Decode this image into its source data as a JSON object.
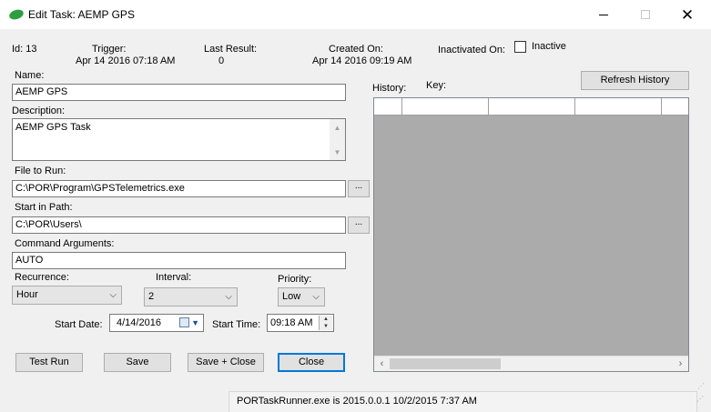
{
  "window": {
    "title": "Edit Task: AEMP GPS"
  },
  "info": {
    "id_label": "Id: 13",
    "trigger_label": "Trigger:",
    "trigger_value": "Apr 14 2016 07:18 AM",
    "last_result_label": "Last Result:",
    "last_result_value": "0",
    "created_label": "Created On:",
    "created_value": "Apr 14 2016 09:19 AM",
    "inactivated_label": "Inactivated On:",
    "inactive_label": "Inactive"
  },
  "form": {
    "name_label": "Name:",
    "name_value": "AEMP GPS",
    "description_label": "Description:",
    "description_value": "AEMP GPS Task",
    "file_label": "File to Run:",
    "file_value": "C:\\POR\\Program\\GPSTelemetrics.exe",
    "path_label": "Start in Path:",
    "path_value": "C:\\POR\\Users\\",
    "args_label": "Command Arguments:",
    "args_value": "AUTO",
    "browse_label": "...",
    "recurrence_label": "Recurrence:",
    "recurrence_value": "Hour",
    "interval_label": "Interval:",
    "interval_value": "2",
    "priority_label": "Priority:",
    "priority_value": "Low",
    "start_date_label": "Start Date:",
    "start_date_value": "4/14/2016",
    "start_time_label": "Start Time:",
    "start_time_value": "09:18 AM"
  },
  "buttons": {
    "test_run": "Test Run",
    "save": "Save",
    "save_close": "Save + Close",
    "close": "Close",
    "refresh_history": "Refresh History"
  },
  "history": {
    "history_label": "History:",
    "key_label": "Key:"
  },
  "status": {
    "text": "PORTaskRunner.exe is 2015.0.0.1 10/2/2015 7:37 AM"
  }
}
